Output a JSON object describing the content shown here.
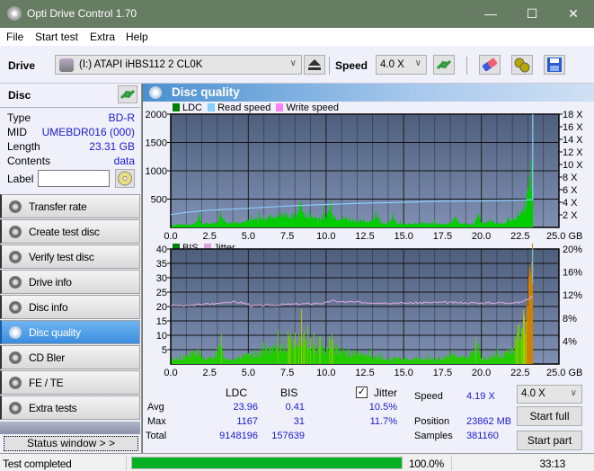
{
  "window": {
    "title": "Opti Drive Control 1.70",
    "minimize_glyph": "—",
    "maximize_glyph": "☐",
    "close_glyph": "✕"
  },
  "menu": {
    "items": [
      {
        "label": "File",
        "accel": "F"
      },
      {
        "label": "Start test",
        "accel": "S"
      },
      {
        "label": "Extra",
        "accel": "x"
      },
      {
        "label": "Help",
        "accel": "H"
      }
    ]
  },
  "toolbar": {
    "drive_label": "Drive",
    "drive_value": "(I:)   ATAPI iHBS112   2 CL0K",
    "speed_label": "Speed",
    "speed_value": "4.0 X",
    "icons": [
      "eject-icon",
      "refresh-icon",
      "erase-icon",
      "settings-icon",
      "save-icon"
    ]
  },
  "disc": {
    "header": "Disc",
    "fields": [
      {
        "key": "Type",
        "value": "BD-R"
      },
      {
        "key": "MID",
        "value": "UMEBDR016 (000)"
      },
      {
        "key": "Length",
        "value": "23.31 GB"
      },
      {
        "key": "Contents",
        "value": "data"
      }
    ],
    "label_key": "Label",
    "label_value": ""
  },
  "nav": {
    "items": [
      {
        "label": "Transfer rate",
        "active": false
      },
      {
        "label": "Create test disc",
        "active": false
      },
      {
        "label": "Verify test disc",
        "active": false
      },
      {
        "label": "Drive info",
        "active": false
      },
      {
        "label": "Disc info",
        "active": false
      },
      {
        "label": "Disc quality",
        "active": true
      },
      {
        "label": "CD Bler",
        "active": false
      },
      {
        "label": "FE / TE",
        "active": false
      },
      {
        "label": "Extra tests",
        "active": false
      }
    ],
    "status_window_label": "Status window > >"
  },
  "panel": {
    "title": "Disc quality"
  },
  "chart_data": [
    {
      "type": "bar",
      "title": "LDC / Read speed",
      "legend": [
        "LDC",
        "Read speed",
        "Write speed"
      ],
      "legend_colors": {
        "LDC": "#008000",
        "Read speed": "#87cefa",
        "Write speed": "#ff80ff"
      },
      "xlabel": "GB",
      "xlim": [
        0,
        25
      ],
      "x_ticks": [
        "0.0",
        "2.5",
        "5.0",
        "7.5",
        "10.0",
        "12.5",
        "15.0",
        "17.5",
        "20.0",
        "22.5",
        "25.0 GB"
      ],
      "ylim": [
        0,
        2000
      ],
      "y_ticks": [
        "500",
        "1000",
        "1500",
        "2000"
      ],
      "y2lim": [
        0,
        18
      ],
      "y2_ticks": [
        "2 X",
        "4 X",
        "6 X",
        "8 X",
        "10 X",
        "12 X",
        "14 X",
        "16 X",
        "18 X"
      ],
      "ldc_profile": [
        [
          0.0,
          40
        ],
        [
          0.5,
          60
        ],
        [
          1.0,
          50
        ],
        [
          1.5,
          70
        ],
        [
          1.8,
          230
        ],
        [
          2.0,
          60
        ],
        [
          2.5,
          80
        ],
        [
          3.0,
          90
        ],
        [
          3.2,
          290
        ],
        [
          3.5,
          90
        ],
        [
          4.0,
          100
        ],
        [
          4.5,
          110
        ],
        [
          5.0,
          120
        ],
        [
          5.5,
          150
        ],
        [
          6.0,
          190
        ],
        [
          6.5,
          210
        ],
        [
          7.0,
          230
        ],
        [
          7.5,
          240
        ],
        [
          8.0,
          210
        ],
        [
          8.4,
          480
        ],
        [
          8.6,
          200
        ],
        [
          9.0,
          210
        ],
        [
          9.5,
          180
        ],
        [
          10.0,
          200
        ],
        [
          10.3,
          470
        ],
        [
          10.5,
          200
        ],
        [
          11.0,
          180
        ],
        [
          11.5,
          160
        ],
        [
          12.0,
          130
        ],
        [
          12.5,
          110
        ],
        [
          13.0,
          140
        ],
        [
          13.2,
          270
        ],
        [
          13.5,
          90
        ],
        [
          14.0,
          80
        ],
        [
          14.3,
          220
        ],
        [
          14.5,
          70
        ],
        [
          15.0,
          60
        ],
        [
          15.5,
          80
        ],
        [
          16.0,
          90
        ],
        [
          16.5,
          80
        ],
        [
          17.0,
          70
        ],
        [
          17.5,
          60
        ],
        [
          18.0,
          90
        ],
        [
          18.3,
          230
        ],
        [
          18.5,
          80
        ],
        [
          19.0,
          70
        ],
        [
          19.5,
          60
        ],
        [
          19.8,
          240
        ],
        [
          20.0,
          60
        ],
        [
          20.5,
          130
        ],
        [
          21.0,
          80
        ],
        [
          21.5,
          90
        ],
        [
          22.0,
          150
        ],
        [
          22.5,
          280
        ],
        [
          22.8,
          450
        ],
        [
          23.0,
          700
        ],
        [
          23.2,
          1050
        ],
        [
          23.31,
          900
        ]
      ],
      "read_speed_profile": [
        [
          0.0,
          2.05
        ],
        [
          1.0,
          2.4
        ],
        [
          2.5,
          2.75
        ],
        [
          5.0,
          3.05
        ],
        [
          7.5,
          3.4
        ],
        [
          10.0,
          3.65
        ],
        [
          12.5,
          3.85
        ],
        [
          15.0,
          4.0
        ],
        [
          17.5,
          4.15
        ],
        [
          20.0,
          4.2
        ],
        [
          22.5,
          4.35
        ],
        [
          23.31,
          4.4
        ],
        [
          23.31,
          18
        ]
      ]
    },
    {
      "type": "bar",
      "title": "BIS / Jitter",
      "legend": [
        "BIS",
        "Jitter"
      ],
      "legend_colors": {
        "BIS": "#008000",
        "Jitter": "#e0a0e0"
      },
      "xlabel": "GB",
      "xlim": [
        0,
        25
      ],
      "x_ticks": [
        "0.0",
        "2.5",
        "5.0",
        "7.5",
        "10.0",
        "12.5",
        "15.0",
        "17.5",
        "20.0",
        "22.5",
        "25.0 GB"
      ],
      "ylim": [
        0,
        40
      ],
      "y_ticks": [
        "5",
        "10",
        "15",
        "20",
        "25",
        "30",
        "35",
        "40"
      ],
      "y2lim": [
        0,
        20
      ],
      "y2_ticks": [
        "4%",
        "8%",
        "12%",
        "16%",
        "20%"
      ],
      "bis_profile": [
        [
          0.0,
          2
        ],
        [
          0.5,
          2
        ],
        [
          1.0,
          3
        ],
        [
          1.8,
          5
        ],
        [
          2.0,
          2
        ],
        [
          2.5,
          2
        ],
        [
          3.2,
          6
        ],
        [
          3.5,
          2
        ],
        [
          4.0,
          2
        ],
        [
          4.5,
          3
        ],
        [
          5.0,
          3
        ],
        [
          5.5,
          4
        ],
        [
          6.0,
          6
        ],
        [
          6.5,
          5
        ],
        [
          7.0,
          6
        ],
        [
          7.5,
          8
        ],
        [
          8.0,
          9
        ],
        [
          8.4,
          11
        ],
        [
          8.8,
          8
        ],
        [
          9.0,
          7
        ],
        [
          9.5,
          5
        ],
        [
          10.0,
          7
        ],
        [
          10.3,
          10
        ],
        [
          10.5,
          6
        ],
        [
          11.0,
          5
        ],
        [
          11.5,
          4
        ],
        [
          12.0,
          4
        ],
        [
          12.5,
          3
        ],
        [
          13.0,
          3
        ],
        [
          13.5,
          2
        ],
        [
          14.0,
          2
        ],
        [
          15.0,
          2
        ],
        [
          16.0,
          2
        ],
        [
          17.0,
          2
        ],
        [
          18.0,
          3
        ],
        [
          19.0,
          3
        ],
        [
          19.8,
          6
        ],
        [
          20.0,
          2
        ],
        [
          21.0,
          3
        ],
        [
          21.5,
          4
        ],
        [
          22.0,
          6
        ],
        [
          22.3,
          10
        ],
        [
          22.6,
          14
        ],
        [
          22.8,
          18
        ],
        [
          23.0,
          25
        ],
        [
          23.2,
          31
        ],
        [
          23.31,
          28
        ]
      ],
      "jitter_profile": [
        [
          0.0,
          10.2
        ],
        [
          1.0,
          10.1
        ],
        [
          2.0,
          10.4
        ],
        [
          3.0,
          10.5
        ],
        [
          3.5,
          10.8
        ],
        [
          4.5,
          10.7
        ],
        [
          5.0,
          10.4
        ],
        [
          5.2,
          10.1
        ],
        [
          7.0,
          10.3
        ],
        [
          9.0,
          10.5
        ],
        [
          10.0,
          10.6
        ],
        [
          10.3,
          11.0
        ],
        [
          11.0,
          10.8
        ],
        [
          12.5,
          10.7
        ],
        [
          15.0,
          10.6
        ],
        [
          17.5,
          10.7
        ],
        [
          20.0,
          10.6
        ],
        [
          22.5,
          10.7
        ],
        [
          23.0,
          11.3
        ],
        [
          23.31,
          11.7
        ]
      ]
    }
  ],
  "stats": {
    "col_ldc": "LDC",
    "col_bis": "BIS",
    "jitter_label": "Jitter",
    "jitter_checked": true,
    "rows": [
      {
        "label": "Avg",
        "ldc": "23.96",
        "bis": "0.41",
        "jitter": "10.5%"
      },
      {
        "label": "Max",
        "ldc": "1167",
        "bis": "31",
        "jitter": "11.7%"
      },
      {
        "label": "Total",
        "ldc": "9148196",
        "bis": "157639",
        "jitter": ""
      }
    ],
    "speed_label": "Speed",
    "speed_value": "4.19 X",
    "position_label": "Position",
    "position_value": "23862 MB",
    "samples_label": "Samples",
    "samples_value": "381160",
    "speed_select": "4.0 X",
    "start_full": "Start full",
    "start_part": "Start part"
  },
  "statusbar": {
    "message": "Test completed",
    "progress": 1.0,
    "progress_text": "100.0%",
    "elapsed": "33:13"
  }
}
